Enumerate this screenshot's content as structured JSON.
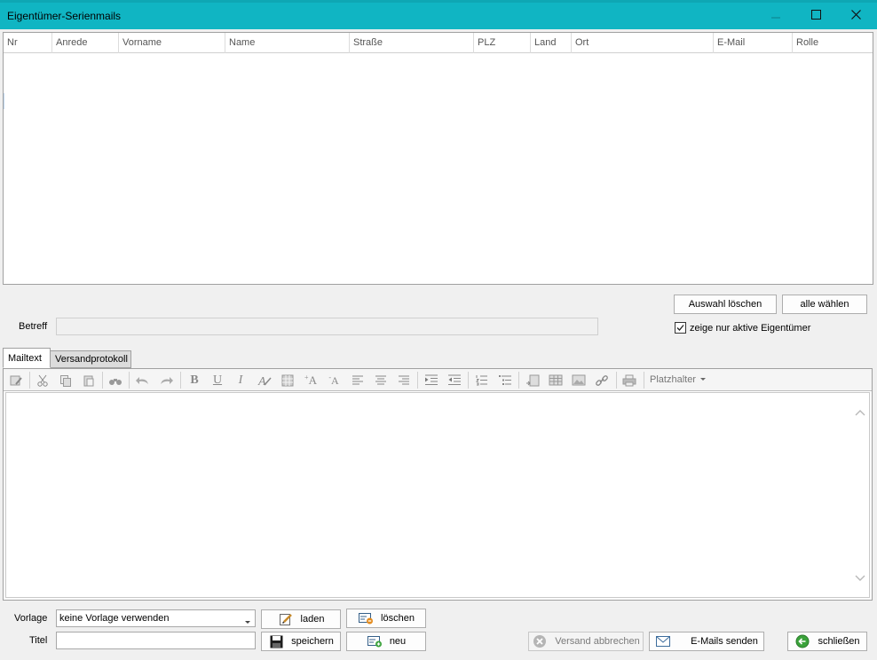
{
  "window": {
    "title": "Eigentümer-Serienmails"
  },
  "grid": {
    "columns": [
      "Nr",
      "Anrede",
      "Vorname",
      "Name",
      "Straße",
      "PLZ",
      "Land",
      "Ort",
      "E-Mail",
      "Rolle"
    ]
  },
  "selection": {
    "clear_label": "Auswahl löschen",
    "select_all_label": "alle wählen",
    "only_active_label": "zeige nur aktive Eigentümer",
    "only_active_checked": true
  },
  "subject": {
    "label": "Betreff",
    "value": ""
  },
  "tabs": [
    {
      "label": "Mailtext"
    },
    {
      "label": "Versandprotokoll"
    }
  ],
  "toolbar": {
    "placeholder_menu_label": "Platzhalter"
  },
  "template": {
    "label": "Vorlage",
    "selected": "keine Vorlage verwenden",
    "load_label": "laden",
    "delete_label": "löschen",
    "save_label": "speichern",
    "new_label": "neu"
  },
  "title_field": {
    "label": "Titel",
    "value": ""
  },
  "actions": {
    "cancel_send_label": "Versand abbrechen",
    "send_label": "E-Mails senden",
    "close_label": "schließen"
  },
  "colors": {
    "titlebar": "#10b5c3",
    "background": "#f0f0f0"
  }
}
